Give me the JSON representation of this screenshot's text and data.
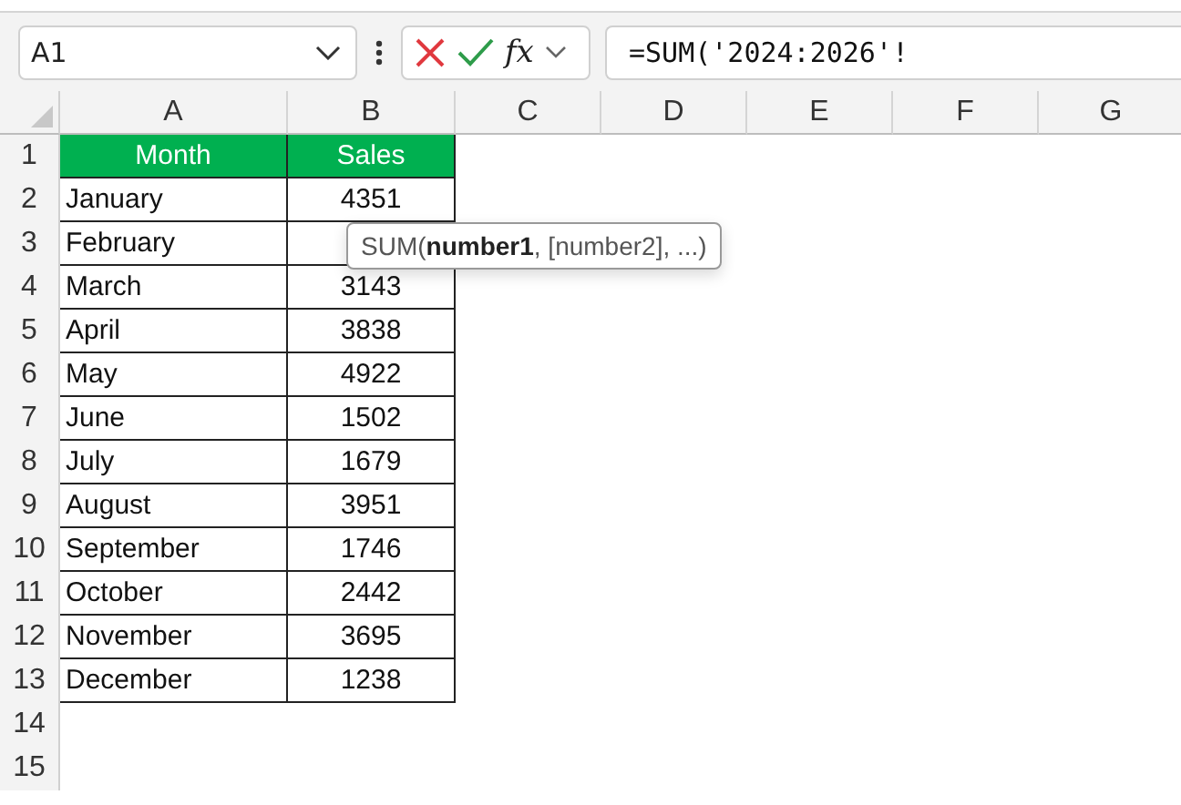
{
  "name_box": {
    "value": "A1"
  },
  "formula_bar": {
    "value": "=SUM('2024:2026'!",
    "fx": "fx"
  },
  "columns": [
    "A",
    "B",
    "C",
    "D",
    "E",
    "F",
    "G"
  ],
  "rows": [
    {
      "number": "1",
      "kind": "header",
      "cells": [
        "Month",
        "Sales"
      ]
    },
    {
      "number": "2",
      "kind": "data",
      "cells": [
        "January",
        "4351"
      ]
    },
    {
      "number": "3",
      "kind": "data",
      "cells": [
        "February"
      ]
    },
    {
      "number": "4",
      "kind": "data",
      "cells": [
        "March",
        "3143"
      ]
    },
    {
      "number": "5",
      "kind": "data",
      "cells": [
        "April",
        "3838"
      ]
    },
    {
      "number": "6",
      "kind": "data",
      "cells": [
        "May",
        "4922"
      ]
    },
    {
      "number": "7",
      "kind": "data",
      "cells": [
        "June",
        "1502"
      ]
    },
    {
      "number": "8",
      "kind": "data",
      "cells": [
        "July",
        "1679"
      ]
    },
    {
      "number": "9",
      "kind": "data",
      "cells": [
        "August",
        "3951"
      ]
    },
    {
      "number": "10",
      "kind": "data",
      "cells": [
        "September",
        "1746"
      ]
    },
    {
      "number": "11",
      "kind": "data",
      "cells": [
        "October",
        "2442"
      ]
    },
    {
      "number": "12",
      "kind": "data",
      "cells": [
        "November",
        "3695"
      ]
    },
    {
      "number": "13",
      "kind": "data",
      "cells": [
        "December",
        "1238"
      ]
    },
    {
      "number": "14",
      "kind": "empty",
      "cells": []
    },
    {
      "number": "15",
      "kind": "empty",
      "cells": []
    }
  ],
  "tooltip": {
    "text": "SUM(**number1**, [number2], ...)"
  }
}
